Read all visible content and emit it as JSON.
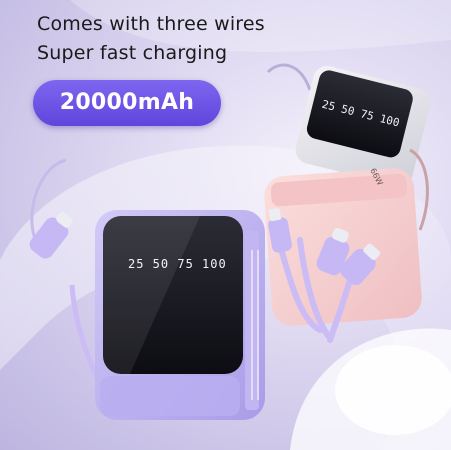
{
  "headline": {
    "line1": "Comes with three wires",
    "line2": "Super fast charging"
  },
  "capacity_badge": "20000mAh",
  "display_readout": "25 50 75 100",
  "back_display_readout": "25 50 75 100",
  "pink_unit_label": "66W",
  "colors": {
    "badge": "#6a50e6",
    "purple_bank": "#b9aef0",
    "pink_bank": "#f6cfd0",
    "background": "#d9d3f0"
  }
}
